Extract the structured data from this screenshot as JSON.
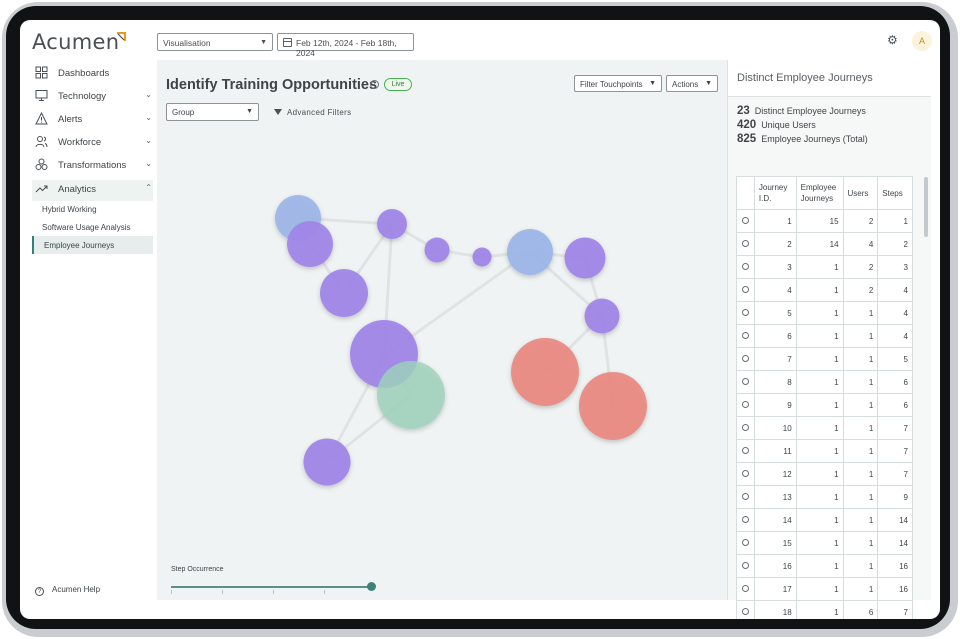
{
  "app": {
    "logo_text": "Acumen",
    "accent": "#e89a1c"
  },
  "header": {
    "view_select": "Visualisation",
    "date_range": "Feb 12th, 2024 - Feb 18th, 2024",
    "avatar_initial": "A"
  },
  "sidebar": {
    "items": [
      {
        "label": "Dashboards",
        "icon": "dashboard-icon"
      },
      {
        "label": "Technology",
        "icon": "monitor-icon"
      },
      {
        "label": "Alerts",
        "icon": "alert-icon"
      },
      {
        "label": "Workforce",
        "icon": "people-icon"
      },
      {
        "label": "Transformations",
        "icon": "transform-icon"
      },
      {
        "label": "Analytics",
        "icon": "analytics-icon"
      }
    ],
    "sub_items": [
      {
        "label": "Hybrid Working"
      },
      {
        "label": "Software Usage Analysis"
      },
      {
        "label": "Employee Journeys"
      }
    ],
    "help_label": "Acumen Help"
  },
  "main": {
    "title": "Identify Training Opportunities",
    "live_badge": "Live",
    "filter_touchpoints": "Filter Touchpoints",
    "actions": "Actions",
    "group_select": "Group",
    "advanced_filters": "Advanced Filters",
    "step_occurrence_label": "Step Occurrence",
    "step_occurrence_value": 1.0,
    "node_colors": {
      "blue": "#9bb5e8",
      "purple": "#a083e8",
      "green": "#9ed2bb",
      "red": "#e98880"
    }
  },
  "panel": {
    "title": "Distinct Employee Journeys",
    "stats": [
      {
        "value": "23",
        "label": "Distinct Employee Journeys"
      },
      {
        "value": "420",
        "label": "Unique Users"
      },
      {
        "value": "825",
        "label": "Employee Journeys (Total)"
      }
    ],
    "columns": [
      "Journey I.D.",
      "Employee Journeys",
      "Users",
      "Steps"
    ],
    "rows": [
      [
        "1",
        "15",
        "2",
        "1"
      ],
      [
        "2",
        "14",
        "4",
        "2"
      ],
      [
        "3",
        "1",
        "2",
        "3"
      ],
      [
        "4",
        "1",
        "2",
        "4"
      ],
      [
        "5",
        "1",
        "1",
        "4"
      ],
      [
        "6",
        "1",
        "1",
        "4"
      ],
      [
        "7",
        "1",
        "1",
        "5"
      ],
      [
        "8",
        "1",
        "1",
        "6"
      ],
      [
        "9",
        "1",
        "1",
        "6"
      ],
      [
        "10",
        "1",
        "1",
        "7"
      ],
      [
        "11",
        "1",
        "1",
        "7"
      ],
      [
        "12",
        "1",
        "1",
        "7"
      ],
      [
        "13",
        "1",
        "1",
        "9"
      ],
      [
        "14",
        "1",
        "1",
        "14"
      ],
      [
        "15",
        "1",
        "1",
        "14"
      ],
      [
        "16",
        "1",
        "1",
        "16"
      ],
      [
        "17",
        "1",
        "1",
        "16"
      ],
      [
        "18",
        "1",
        "6",
        "7"
      ]
    ]
  }
}
